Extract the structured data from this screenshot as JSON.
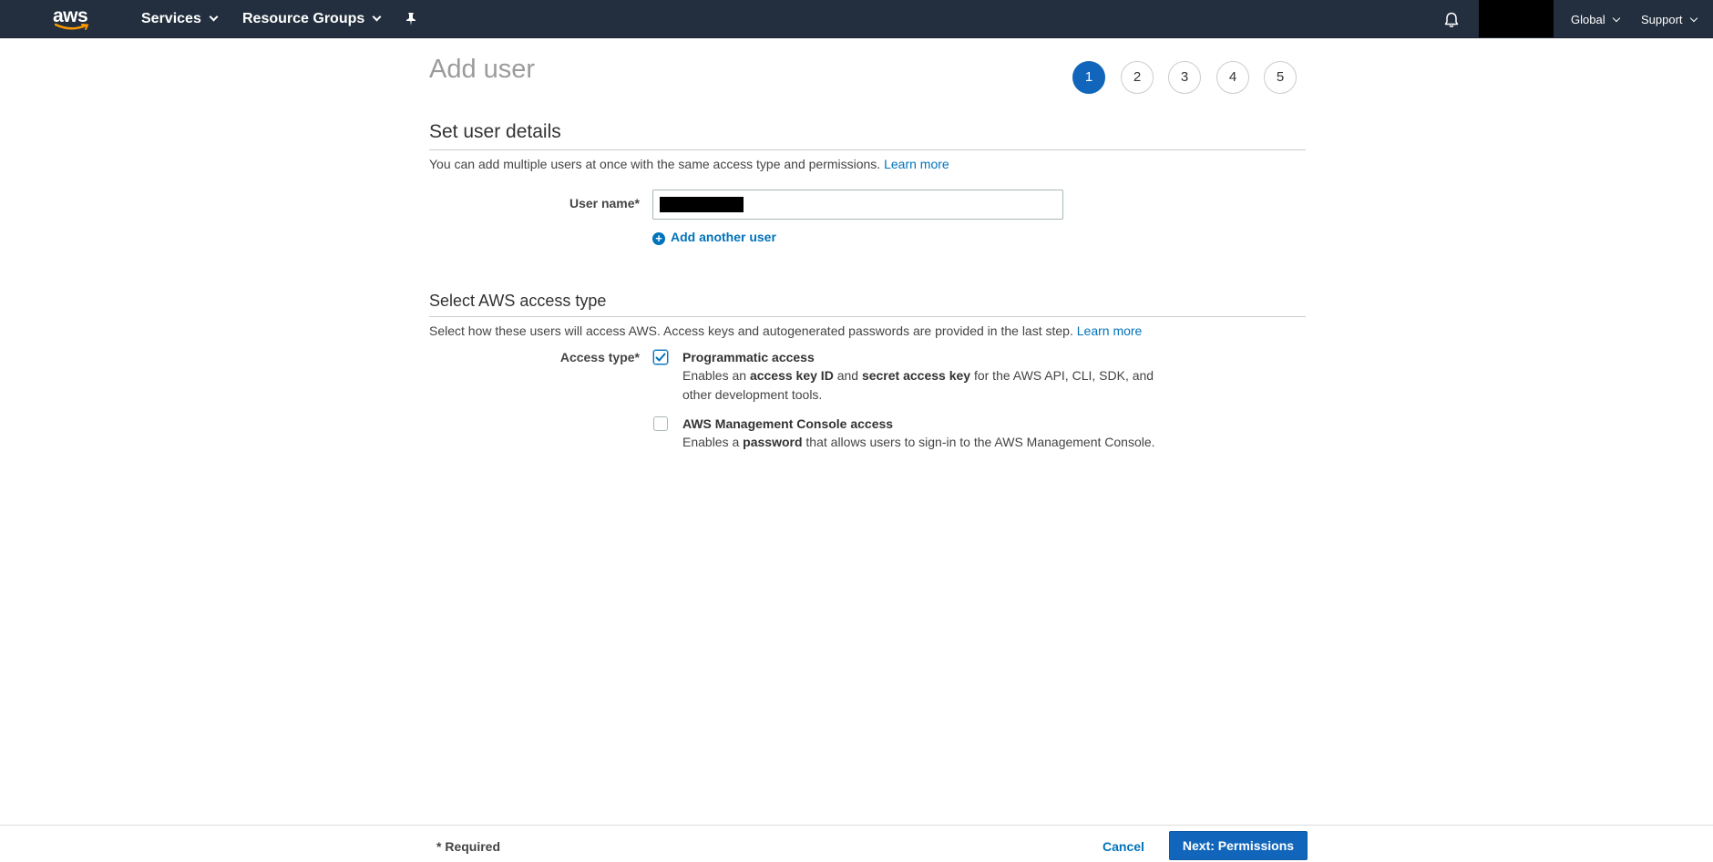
{
  "nav": {
    "logo": "aws",
    "services": "Services",
    "resource_groups": "Resource Groups",
    "region": "Global",
    "support": "Support",
    "icons": [
      "pin-icon",
      "bell-icon"
    ]
  },
  "wizard": {
    "title": "Add user",
    "steps": [
      "1",
      "2",
      "3",
      "4",
      "5"
    ],
    "active_step": 1
  },
  "details": {
    "title": "Set user details",
    "description": "You can add multiple users at once with the same access type and permissions.",
    "learn_more": "Learn more",
    "username_label": "User name*",
    "username_value": "",
    "add_another": "Add another user"
  },
  "access": {
    "title": "Select AWS access type",
    "description": "Select how these users will access AWS. Access keys and autogenerated passwords are provided in the last step.",
    "learn_more": "Learn more",
    "label": "Access type*",
    "options": [
      {
        "title": "Programmatic access",
        "checked": true,
        "desc_pre": "Enables an ",
        "desc_b1": "access key ID",
        "desc_mid": " and ",
        "desc_b2": "secret access key",
        "desc_post": " for the AWS API, CLI, SDK, and other development tools."
      },
      {
        "title": "AWS Management Console access",
        "checked": false,
        "desc_pre": "Enables a ",
        "desc_b1": "password",
        "desc_post": " that allows users to sign-in to the AWS Management Console."
      }
    ]
  },
  "footer": {
    "required": "* Required",
    "cancel": "Cancel",
    "next": "Next: Permissions"
  },
  "colors": {
    "nav_bg": "#232f3e",
    "accent": "#1166bb",
    "link": "#0073bb"
  }
}
